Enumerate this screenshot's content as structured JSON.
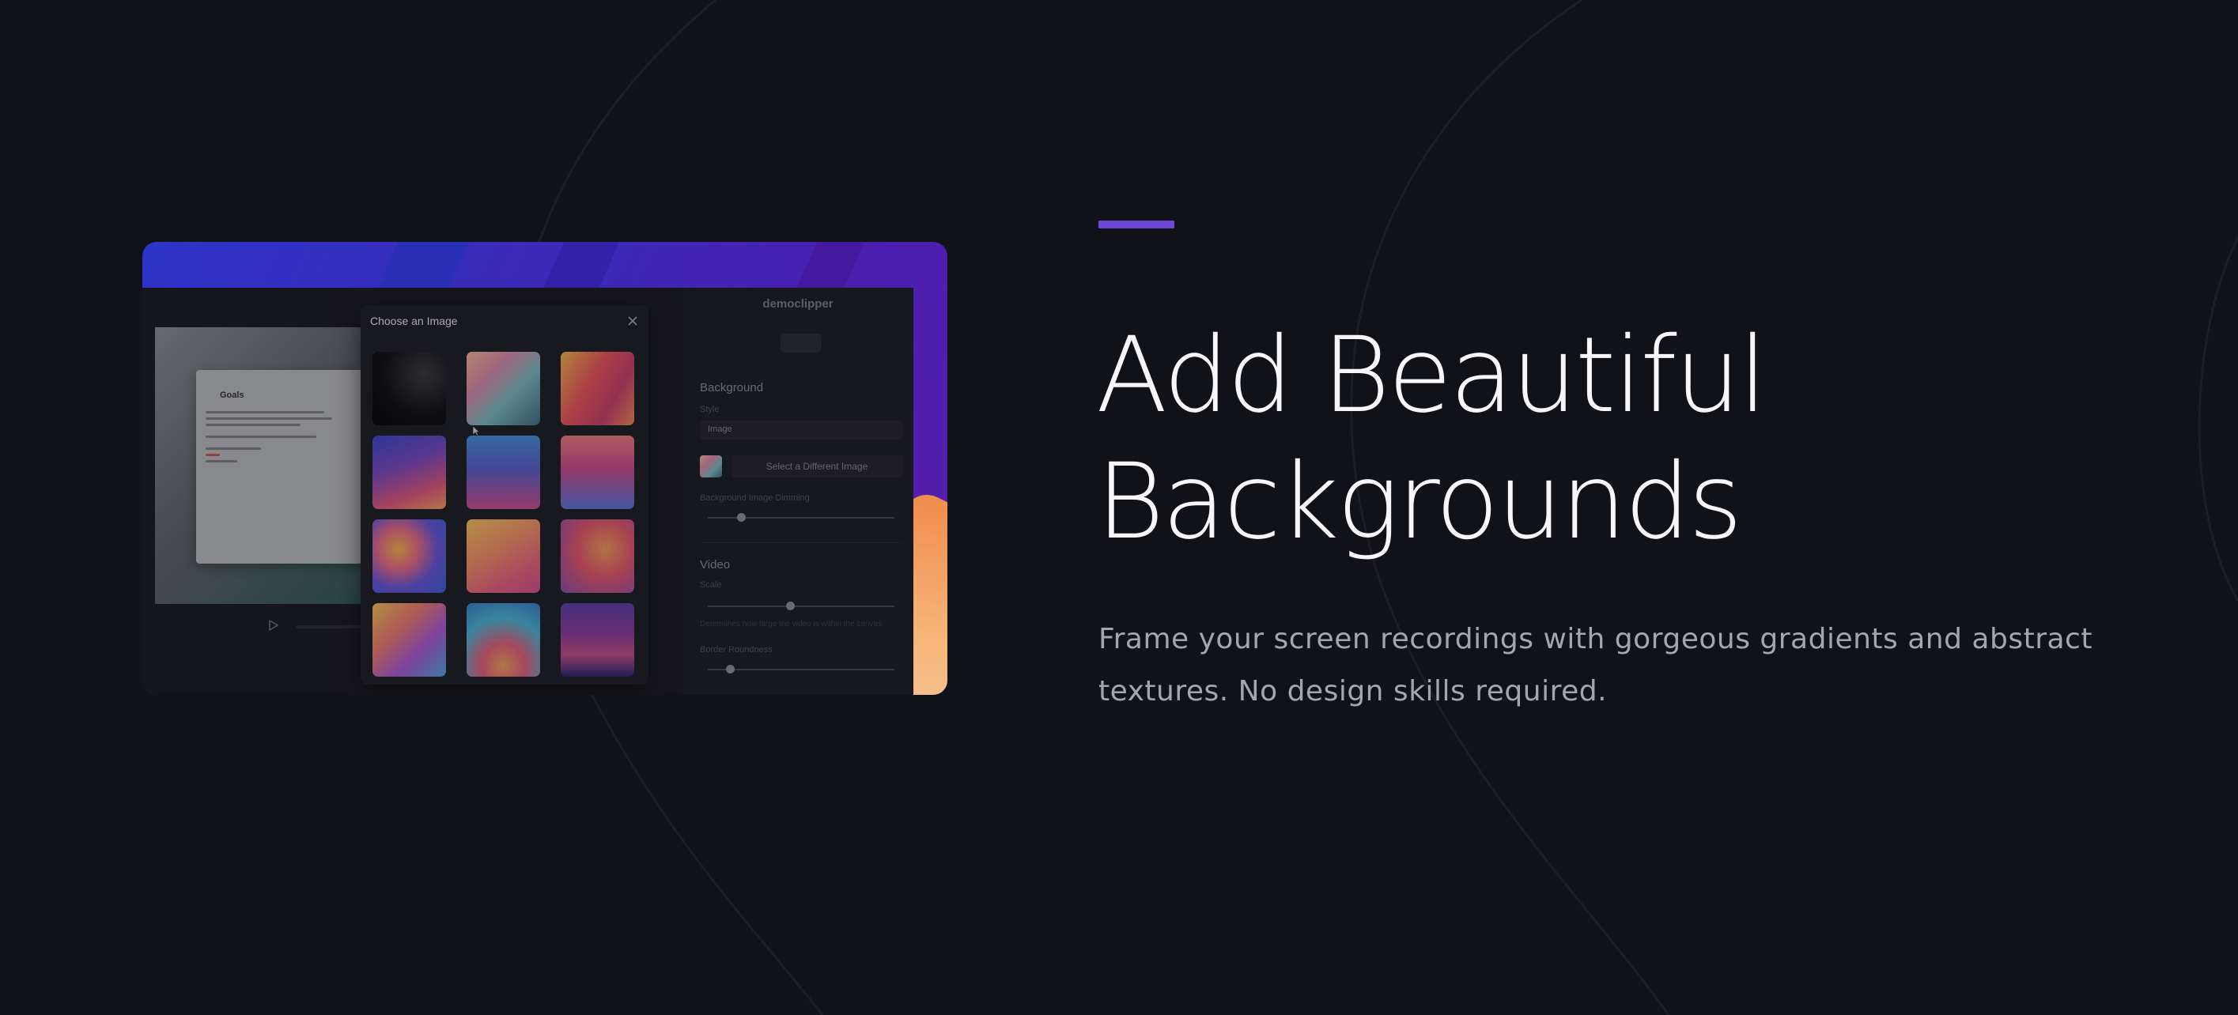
{
  "feature": {
    "title_line1": "Add Beautiful",
    "title_line2": "Backgrounds",
    "description": "Frame your screen recordings with gorgeous gradients and abstract textures. No design skills required.",
    "accent_color": "#6b46d8"
  },
  "screenshot": {
    "dialog_title": "Choose an Image",
    "video_doc_title": "Goals",
    "side_panel": {
      "logo": "democlipper",
      "background_heading": "Background",
      "style_label": "Style",
      "style_value": "Image",
      "select_image_label": "Select a Different Image",
      "dimming_label": "Background Image Dimming",
      "dimming_value": 0.18,
      "video_heading": "Video",
      "scale_label": "Scale",
      "scale_value": 0.44,
      "scale_description": "Determines how large the video is within the canvas",
      "roundness_label": "Border Roundness",
      "roundness_value": 0.12
    },
    "thumbnails": [
      {
        "name": "dark-silk"
      },
      {
        "name": "pastel-folds"
      },
      {
        "name": "coral-chevrons"
      },
      {
        "name": "sunset-fold"
      },
      {
        "name": "blue-v"
      },
      {
        "name": "pink-v"
      },
      {
        "name": "blob-swirl"
      },
      {
        "name": "peach-waves"
      },
      {
        "name": "orange-flow"
      },
      {
        "name": "rainbow-diagonal"
      },
      {
        "name": "sky-circles"
      },
      {
        "name": "purple-dunes"
      }
    ]
  }
}
